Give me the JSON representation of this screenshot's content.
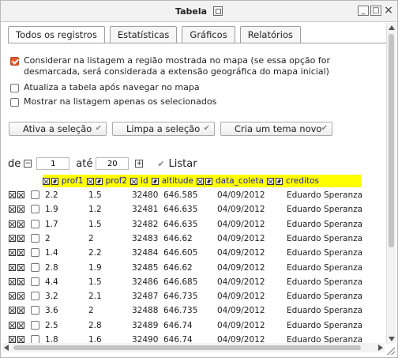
{
  "window": {
    "title": "Tabela",
    "buttons": [
      "_",
      "□",
      "×"
    ]
  },
  "tabs": [
    {
      "label": "Todos os registros",
      "active": true
    },
    {
      "label": "Estatísticas",
      "active": false
    },
    {
      "label": "Gráficos",
      "active": false
    },
    {
      "label": "Relatórios",
      "active": false
    }
  ],
  "options": [
    {
      "label": "Considerar na listagem a região mostrada no mapa (se essa opção for desmarcada, será considerada a extensão geográfica do mapa inicial)",
      "checked": true
    },
    {
      "label": "Atualiza a tabela após navegar no mapa",
      "checked": false
    },
    {
      "label": "Mostrar na listagem apenas os selecionados",
      "checked": false
    }
  ],
  "actions": {
    "activate": "Ativa a seleção",
    "clear": "Limpa a seleção",
    "create_theme": "Cria um tema novo"
  },
  "range": {
    "from_label": "de",
    "from_value": "1",
    "to_label": "até",
    "to_value": "20",
    "list_label": "Listar"
  },
  "columns": [
    "prof1",
    "prof2",
    "id",
    "altitude",
    "data_coleta",
    "creditos"
  ],
  "rows": [
    [
      "2.2",
      "1.5",
      "32480",
      "646.585",
      "04/09/2012",
      "Eduardo Speranza"
    ],
    [
      "1.9",
      "1.2",
      "32481",
      "646.635",
      "04/09/2012",
      "Eduardo Speranza"
    ],
    [
      "1.7",
      "1.5",
      "32482",
      "646.635",
      "04/09/2012",
      "Eduardo Speranza"
    ],
    [
      "2",
      "2",
      "32483",
      "646.62",
      "04/09/2012",
      "Eduardo Speranza"
    ],
    [
      "1.4",
      "2.2",
      "32484",
      "646.605",
      "04/09/2012",
      "Eduardo Speranza"
    ],
    [
      "2.8",
      "1.9",
      "32485",
      "646.62",
      "04/09/2012",
      "Eduardo Speranza"
    ],
    [
      "4.4",
      "1.5",
      "32486",
      "646.685",
      "04/09/2012",
      "Eduardo Speranza"
    ],
    [
      "3.2",
      "2.1",
      "32487",
      "646.735",
      "04/09/2012",
      "Eduardo Speranza"
    ],
    [
      "3.6",
      "2",
      "32488",
      "646.735",
      "04/09/2012",
      "Eduardo Speranza"
    ],
    [
      "2.5",
      "2.8",
      "32489",
      "646.74",
      "04/09/2012",
      "Eduardo Speranza"
    ],
    [
      "1.8",
      "1.6",
      "32490",
      "646.74",
      "04/09/2012",
      "Eduardo Speranza"
    ]
  ],
  "colors": {
    "header_bg": "#ffff00",
    "header_text": "#1a1ab0",
    "checkbox_checked": "#e35b2a"
  }
}
